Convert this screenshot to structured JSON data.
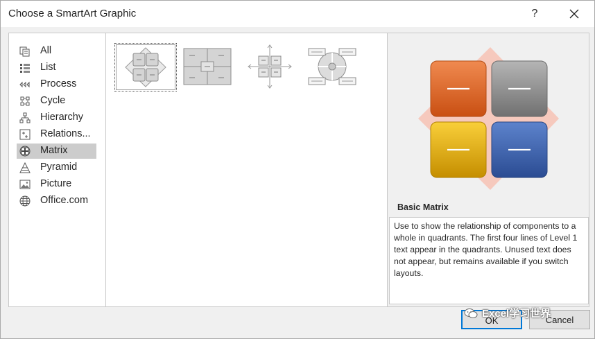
{
  "window": {
    "title": "Choose a SmartArt Graphic",
    "help": "?"
  },
  "categories": [
    {
      "label": "All",
      "icon": "all-icon"
    },
    {
      "label": "List",
      "icon": "list-icon"
    },
    {
      "label": "Process",
      "icon": "process-icon"
    },
    {
      "label": "Cycle",
      "icon": "cycle-icon"
    },
    {
      "label": "Hierarchy",
      "icon": "hierarchy-icon"
    },
    {
      "label": "Relations...",
      "icon": "relationship-icon"
    },
    {
      "label": "Matrix",
      "icon": "matrix-icon",
      "selected": true
    },
    {
      "label": "Pyramid",
      "icon": "pyramid-icon"
    },
    {
      "label": "Picture",
      "icon": "picture-icon"
    },
    {
      "label": "Office.com",
      "icon": "globe-icon"
    }
  ],
  "layouts": [
    {
      "id": "basic-matrix",
      "selected": true
    },
    {
      "id": "titled-matrix"
    },
    {
      "id": "grid-matrix"
    },
    {
      "id": "cycle-matrix"
    }
  ],
  "preview": {
    "title": "Basic Matrix",
    "description": "Use to show the relationship of components to a whole in quadrants. The first four lines of Level 1 text appear in the quadrants. Unused text does not appear, but remains available if you switch layouts.",
    "colors": {
      "top_left": "#e0621f",
      "top_right": "#8c8c8c",
      "bottom_left": "#f0b400",
      "bottom_right": "#3a5ea8",
      "diamond": "#f6c9bd"
    }
  },
  "buttons": {
    "ok": "OK",
    "cancel": "Cancel"
  },
  "watermark": "Excel学习世界"
}
